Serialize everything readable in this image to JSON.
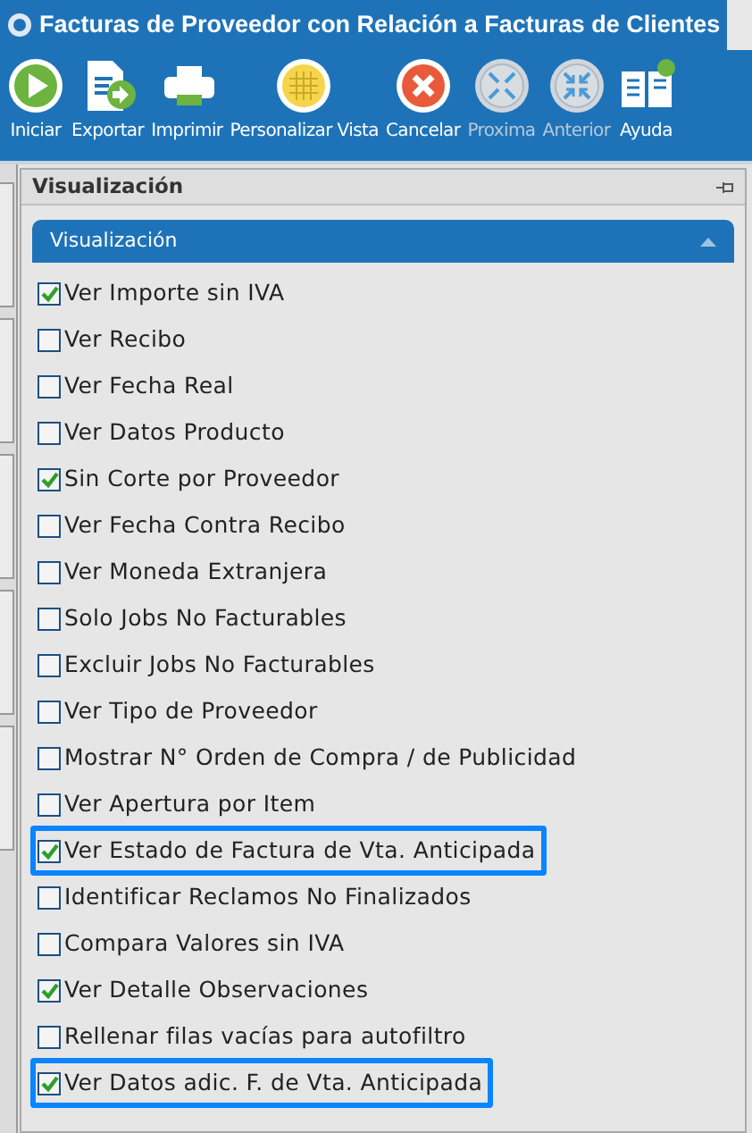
{
  "window": {
    "title": "Facturas de Proveedor con Relación a Facturas de Clientes"
  },
  "toolbar": [
    {
      "label": "Iniciar",
      "kind": "play",
      "disabled": false
    },
    {
      "label": "Exportar",
      "kind": "export",
      "disabled": false
    },
    {
      "label": "Imprimir",
      "kind": "print",
      "disabled": false
    },
    {
      "label": "Personalizar Vista",
      "kind": "grid",
      "disabled": false
    },
    {
      "label": "Cancelar",
      "kind": "cancel",
      "disabled": false
    },
    {
      "label": "Proxima",
      "kind": "expand",
      "disabled": true
    },
    {
      "label": "Anterior",
      "kind": "collapse",
      "disabled": true
    },
    {
      "label": "Ayuda",
      "kind": "help",
      "disabled": false
    }
  ],
  "panel": {
    "title": "Visualización",
    "group": {
      "title": "Visualización",
      "expanded": true,
      "options": [
        {
          "label": "Ver Importe sin IVA",
          "checked": true,
          "highlighted": false
        },
        {
          "label": "Ver Recibo",
          "checked": false,
          "highlighted": false
        },
        {
          "label": "Ver Fecha Real",
          "checked": false,
          "highlighted": false
        },
        {
          "label": "Ver Datos Producto",
          "checked": false,
          "highlighted": false
        },
        {
          "label": "Sin Corte por Proveedor",
          "checked": true,
          "highlighted": false
        },
        {
          "label": "Ver Fecha Contra Recibo",
          "checked": false,
          "highlighted": false
        },
        {
          "label": "Ver Moneda Extranjera",
          "checked": false,
          "highlighted": false
        },
        {
          "label": "Solo Jobs No Facturables",
          "checked": false,
          "highlighted": false
        },
        {
          "label": "Excluir Jobs No Facturables",
          "checked": false,
          "highlighted": false
        },
        {
          "label": "Ver Tipo de Proveedor",
          "checked": false,
          "highlighted": false
        },
        {
          "label": "Mostrar N° Orden de Compra / de Publicidad",
          "checked": false,
          "highlighted": false
        },
        {
          "label": "Ver Apertura por Item",
          "checked": false,
          "highlighted": false
        },
        {
          "label": "Ver Estado de Factura de Vta. Anticipada",
          "checked": true,
          "highlighted": true
        },
        {
          "label": "Identificar Reclamos No Finalizados",
          "checked": false,
          "highlighted": false
        },
        {
          "label": "Compara Valores sin IVA",
          "checked": false,
          "highlighted": false
        },
        {
          "label": "Ver Detalle Observaciones",
          "checked": true,
          "highlighted": false
        },
        {
          "label": "Rellenar filas vacías para autofiltro",
          "checked": false,
          "highlighted": false
        },
        {
          "label": "Ver Datos adic. F. de Vta. Anticipada",
          "checked": true,
          "highlighted": true
        }
      ]
    }
  }
}
